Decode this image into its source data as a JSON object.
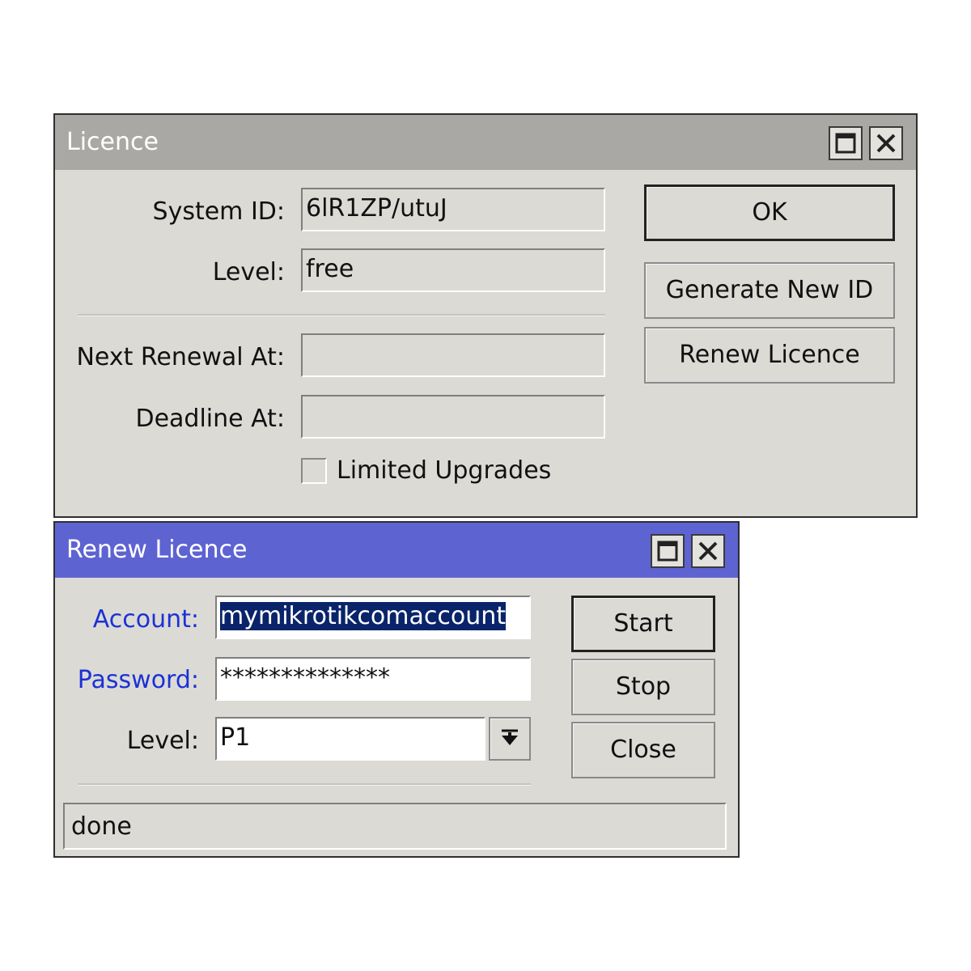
{
  "licence_window": {
    "title": "Licence",
    "title_bar_color": "#aaa8a4",
    "system_id_label": "System ID:",
    "system_id_value": "6lR1ZP/utuJ",
    "level_label": "Level:",
    "level_value": "free",
    "next_renewal_label": "Next Renewal At:",
    "next_renewal_value": "",
    "deadline_label": "Deadline At:",
    "deadline_value": "",
    "limited_upgrades_label": "Limited Upgrades",
    "limited_upgrades_checked": false,
    "ok_label": "OK",
    "generate_label": "Generate New ID",
    "renew_label": "Renew Licence"
  },
  "renew_window": {
    "title": "Renew Licence",
    "title_bar_color": "#5e63d2",
    "account_label": "Account:",
    "account_value": "mymikrotikcomaccount",
    "password_label": "Password:",
    "password_value": "**************",
    "level_label": "Level:",
    "level_value": "P1",
    "start_label": "Start",
    "stop_label": "Stop",
    "close_label": "Close",
    "status_text": "done"
  },
  "icons": {
    "maximize": "maximize-icon",
    "close": "close-icon",
    "dropdown": "dropdown-arrow-icon"
  }
}
